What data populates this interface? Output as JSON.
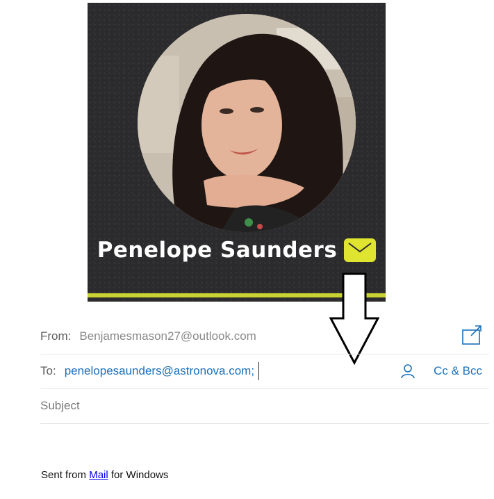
{
  "card": {
    "name": "Penelope Saunders",
    "accent_color": "#dfe430",
    "stripe_color": "#c8d233",
    "background_color": "#2b2b2d",
    "badge_icon": "envelope-icon"
  },
  "compose": {
    "from_label": "From:",
    "from_value": "Benjamesmason27@outlook.com",
    "to_label": "To:",
    "to_value": "penelopesaunders@astronova.com;",
    "cc_bcc_label": "Cc & Bcc",
    "subject_placeholder": "Subject",
    "popout_icon": "popout-window-icon",
    "contact_icon": "person-icon",
    "link_color": "#1a6fb8"
  },
  "signature": {
    "prefix": "Sent from ",
    "link_text": "Mail",
    "suffix": " for Windows"
  },
  "annotation": {
    "arrow_icon": "down-arrow-icon"
  }
}
